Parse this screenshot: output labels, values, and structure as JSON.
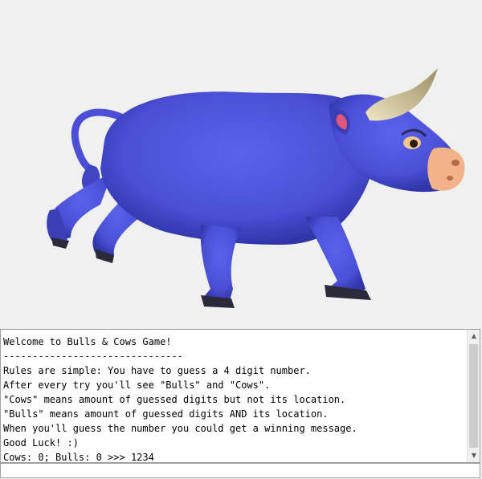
{
  "game": {
    "console_lines": [
      "Welcome to Bulls & Cows Game!",
      "-------------------------------",
      "Rules are simple: You have to guess a 4 digit number.",
      "After every try you'll see \"Bulls\" and \"Cows\".",
      "\"Cows\" means amount of guessed digits but not its location.",
      "\"Bulls\" means amount of guessed digits AND its location.",
      "When you'll guess the number you could get a winning message.",
      "Good Luck! :)",
      "Cows: 0; Bulls: 0 >>> 1234"
    ],
    "input_value": "",
    "scroll_up_icon": "triangle-up",
    "scroll_down_icon": "triangle-down"
  },
  "colors": {
    "bull_body": "#4a4fd6",
    "bull_shadow": "#2f2f9a",
    "horn": "#e8dcb0",
    "nose": "#f2b38a"
  }
}
